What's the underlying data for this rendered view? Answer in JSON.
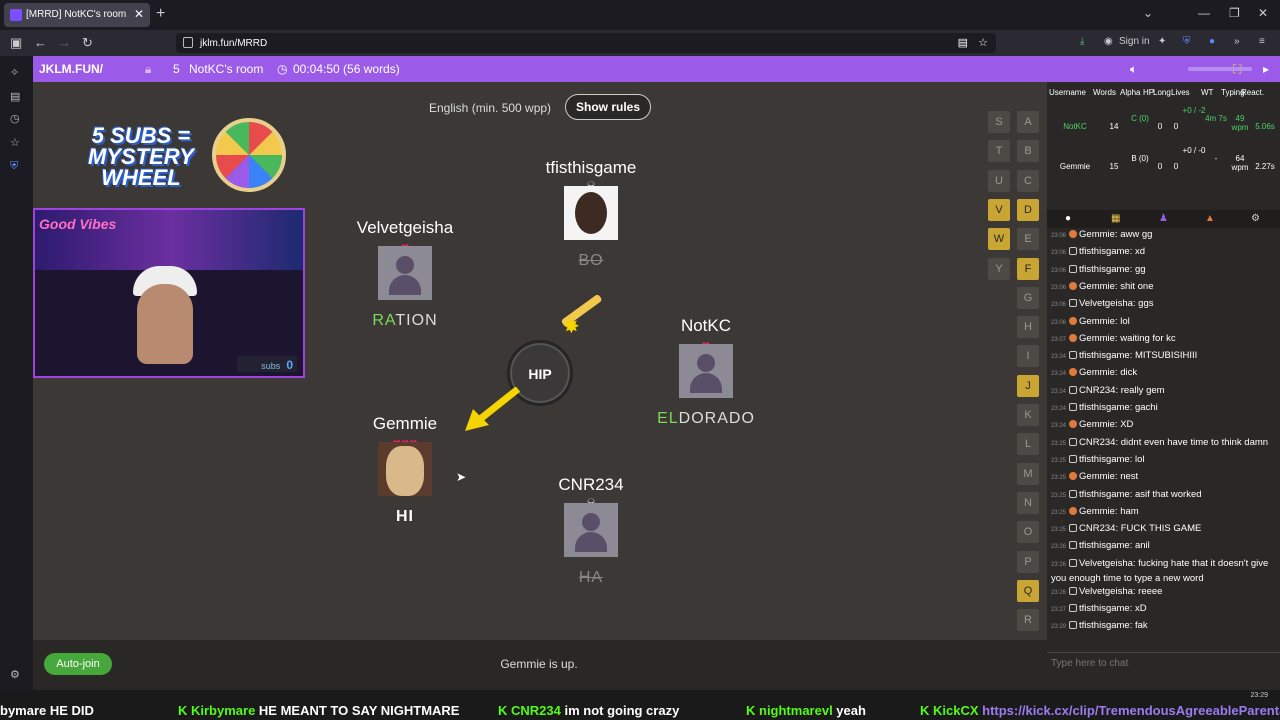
{
  "browser": {
    "tab_title": "[MRRD] NotKC's room",
    "url": "jklm.fun/MRRD",
    "sign_in": "Sign in"
  },
  "game_header": {
    "site": "JKLM.FUN/",
    "player_count": "5",
    "room_name": "NotKC's room",
    "timer": "00:04:50 (56 words)"
  },
  "overlay": {
    "promo_text": "5 SUBS = MYSTERY WHEEL",
    "cam_label": "Good Vibes",
    "subs_label": "subs",
    "subs_count": "0"
  },
  "game": {
    "language": "English (min. 500 wpp)",
    "rules_button": "Show rules",
    "prompt": "HIP",
    "status": "Gemmie is up.",
    "auto_join": "Auto-join"
  },
  "players": {
    "tfisthisgame": {
      "name": "tfisthisgame",
      "word": "BO"
    },
    "velvetgeisha": {
      "name": "Velvetgeisha",
      "word_highlight": "RA",
      "word_rest": "TION"
    },
    "notkc": {
      "name": "NotKC",
      "word_highlight": "EL",
      "word_rest": "DORADO"
    },
    "gemmie": {
      "name": "Gemmie",
      "word": "HI"
    },
    "cnr234": {
      "name": "CNR234",
      "word": "HA"
    }
  },
  "bonus_letters": {
    "col1": [
      "S",
      "T",
      "U",
      "V",
      "W",
      "Y"
    ],
    "col2": [
      "A",
      "B",
      "C",
      "D",
      "E",
      "F",
      "G",
      "H",
      "I",
      "J",
      "K",
      "L",
      "M",
      "N",
      "O",
      "P",
      "Q",
      "R"
    ],
    "used": [
      "V",
      "W",
      "D",
      "F",
      "J",
      "Q"
    ]
  },
  "leaderboard": {
    "headers": [
      "Username",
      "Words",
      "Alpha",
      "HP",
      "Long",
      "Lives",
      "WT",
      "Typing",
      "React."
    ],
    "rows": [
      {
        "user": "NotKC",
        "words": "14",
        "alpha": "C (0)",
        "hp": "0",
        "long": "0",
        "lives": "+0 / -2",
        "wt": "4m 7s",
        "typing": "49 wpm",
        "react": "5.06s"
      },
      {
        "user": "Gemmie",
        "words": "15",
        "alpha": "B (0)",
        "hp": "0",
        "long": "0",
        "lives": "+0 / -0",
        "wt": "-",
        "typing": "64 wpm",
        "react": "2.27s"
      }
    ]
  },
  "chat": {
    "messages": [
      {
        "time": "23:06",
        "user": "Gemmie",
        "text": "aww gg"
      },
      {
        "time": "23:06",
        "user": "tfisthisgame",
        "text": "xd"
      },
      {
        "time": "23:06",
        "user": "tfisthisgame",
        "text": "gg"
      },
      {
        "time": "23:06",
        "user": "Gemmie",
        "text": "shit one"
      },
      {
        "time": "23:06",
        "user": "Velvetgeisha",
        "text": "ggs"
      },
      {
        "time": "23:06",
        "user": "Gemmie",
        "text": "lol"
      },
      {
        "time": "23:07",
        "user": "Gemmie",
        "text": "waiting for kc"
      },
      {
        "time": "23:24",
        "user": "tfisthisgame",
        "text": "MITSUBISIHIII"
      },
      {
        "time": "23:24",
        "user": "Gemmie",
        "text": "dick"
      },
      {
        "time": "23:24",
        "user": "CNR234",
        "text": "really gem"
      },
      {
        "time": "23:24",
        "user": "tfisthisgame",
        "text": "gachi"
      },
      {
        "time": "23:24",
        "user": "Gemmie",
        "text": "XD"
      },
      {
        "time": "23:25",
        "user": "CNR234",
        "text": "didnt even have time to think damn"
      },
      {
        "time": "23:25",
        "user": "tfisthisgame",
        "text": "lol"
      },
      {
        "time": "23:25",
        "user": "Gemmie",
        "text": "nest"
      },
      {
        "time": "23:25",
        "user": "tfisthisgame",
        "text": "asif that worked"
      },
      {
        "time": "23:25",
        "user": "Gemmie",
        "text": "ham"
      },
      {
        "time": "23:25",
        "user": "CNR234",
        "text": "FUCK THIS GAME"
      },
      {
        "time": "23:26",
        "user": "tfisthisgame",
        "text": "anil"
      },
      {
        "time": "23:26",
        "user": "Velvetgeisha",
        "text": "fucking hate that it doesn't give you enough time to type a new word"
      },
      {
        "time": "23:26",
        "user": "Velvetgeisha",
        "text": "reeee"
      },
      {
        "time": "23:27",
        "user": "tfisthisgame",
        "text": "xD"
      },
      {
        "time": "23:29",
        "user": "tfisthisgame",
        "text": "fak"
      }
    ],
    "input_placeholder": "Type here to chat"
  },
  "ticker": {
    "items": [
      {
        "user": "bymare",
        "text": "HE DID"
      },
      {
        "user": "Kirbymare",
        "text": "HE MEANT TO SAY NIGHTMARE"
      },
      {
        "user": "CNR234",
        "text": "im not going crazy"
      },
      {
        "user": "nightmarevl",
        "text": "yeah"
      },
      {
        "user": "KickCX",
        "text": "https://kick.cx/clip/TremendousAgreeableParental"
      }
    ]
  },
  "taskbar": {
    "time": "23:29"
  },
  "colors": {
    "accent": "#9b5be8",
    "used_letter": "#c9a634",
    "highlight": "#7ed957",
    "heart": "#e8235a",
    "kick_green": "#53fc18"
  }
}
